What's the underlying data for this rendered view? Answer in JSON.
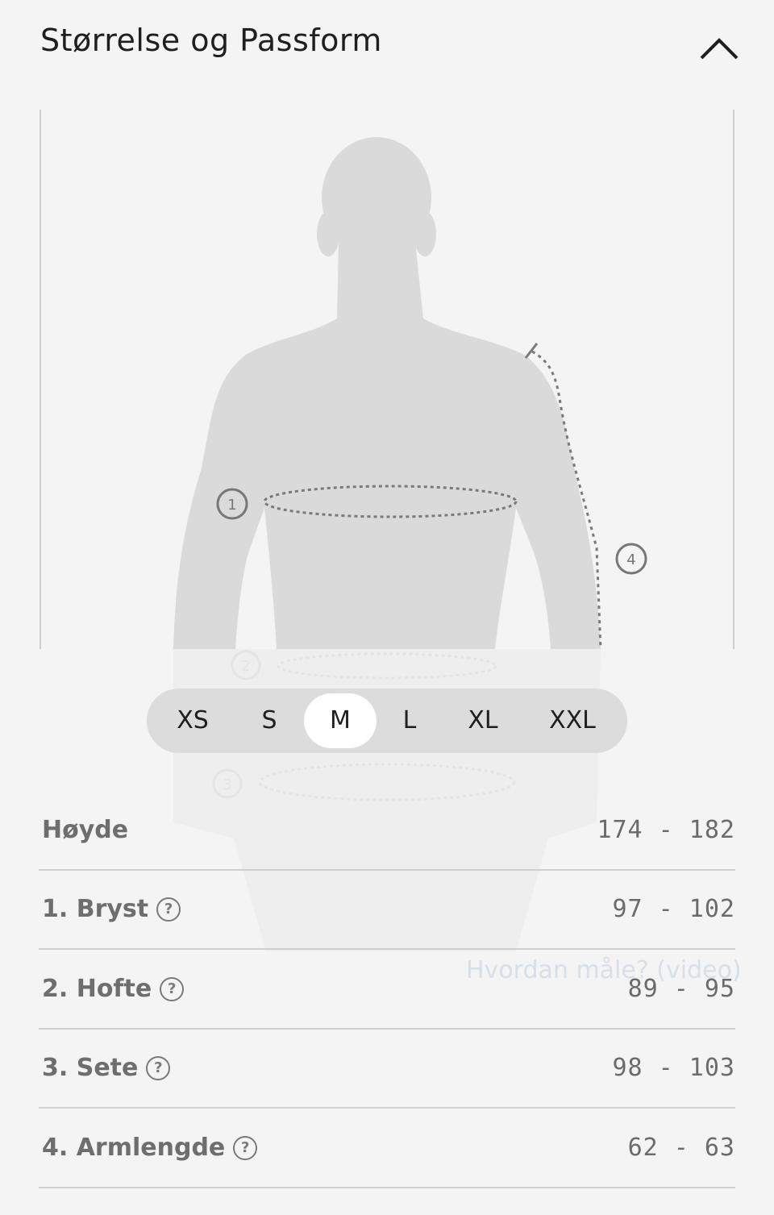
{
  "header": {
    "title": "Størrelse og Passform"
  },
  "measurement_markers": [
    "1",
    "4",
    "2",
    "3"
  ],
  "sizes": [
    "XS",
    "S",
    "M",
    "L",
    "XL",
    "XXL"
  ],
  "selected_size": "M",
  "video_link": "Hvordan måle? (video)",
  "measurements": [
    {
      "label": "Høyde",
      "value": "174 - 182",
      "help": false
    },
    {
      "label": "1. Bryst",
      "value": "97 - 102",
      "help": true
    },
    {
      "label": "2. Hofte",
      "value": "89 - 95",
      "help": true
    },
    {
      "label": "3. Sete",
      "value": "98 - 103",
      "help": true
    },
    {
      "label": "4. Armlengde",
      "value": "62 - 63",
      "help": true
    }
  ],
  "help_icon_glyph": "?",
  "colors": {
    "background": "#f4f4f4",
    "silhouette": "#dadada",
    "selector_bg": "#dcdcdc",
    "selected_bg": "#ffffff"
  }
}
